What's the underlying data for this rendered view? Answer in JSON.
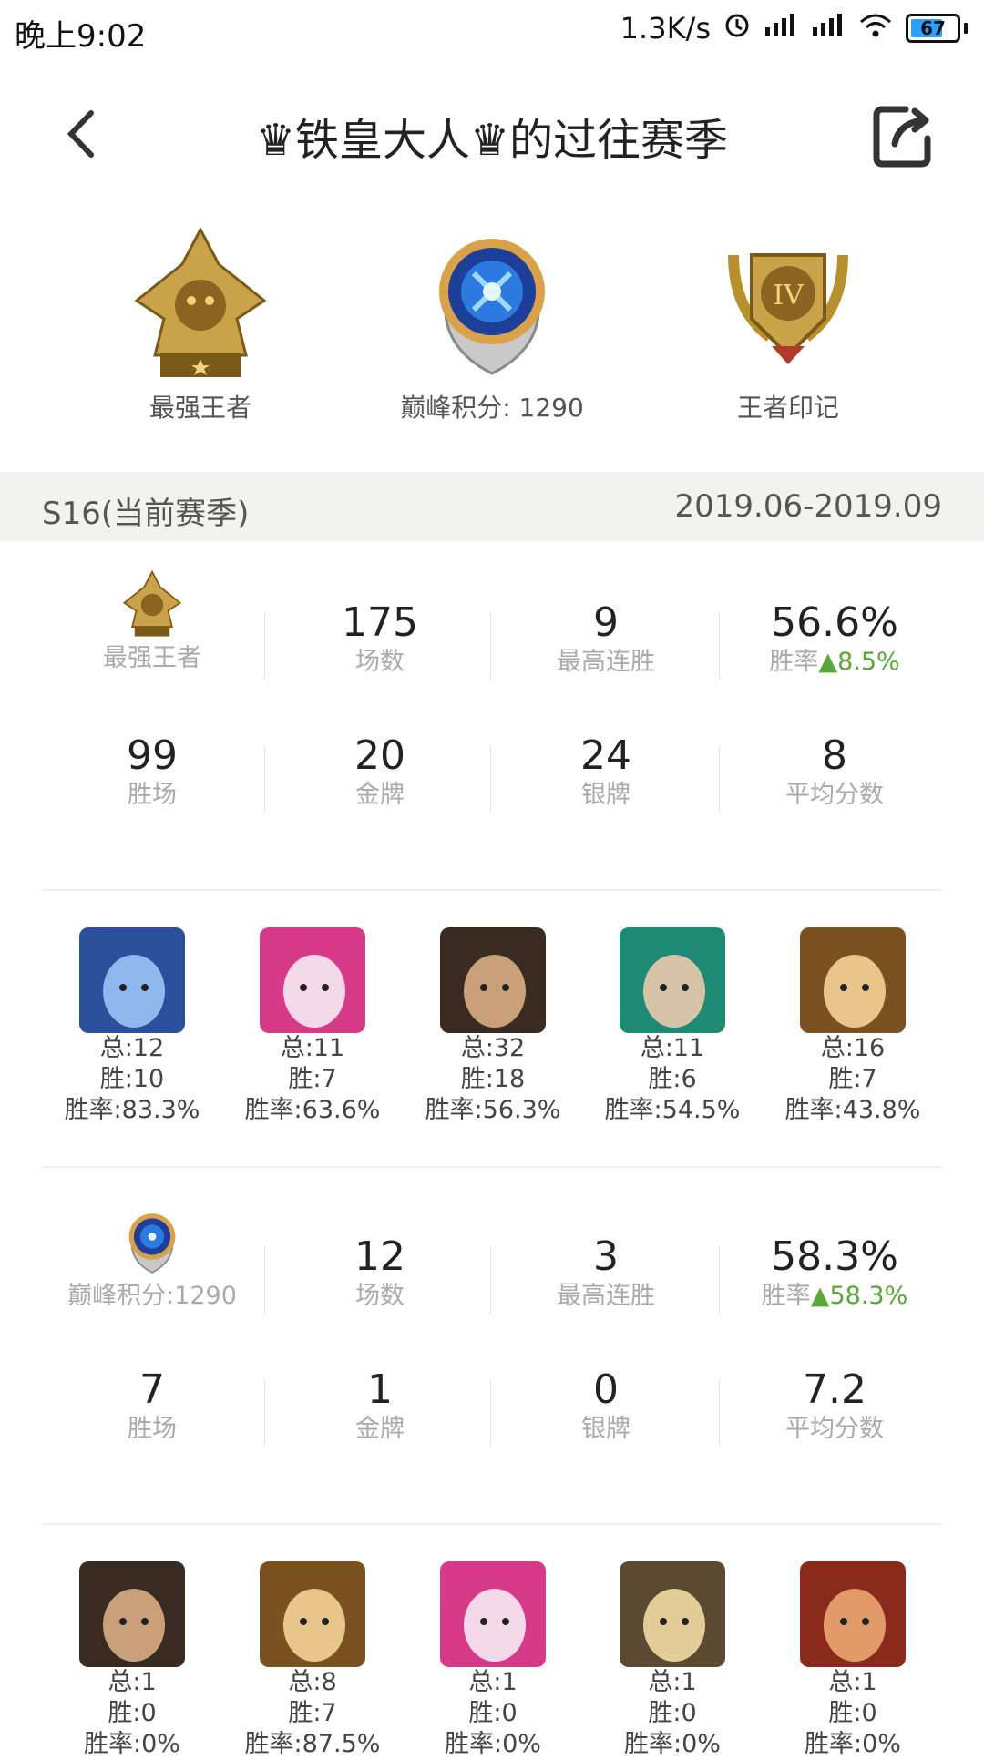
{
  "status_bar": {
    "time": "晚上9:02",
    "speed": "1.3K/s",
    "battery": "67"
  },
  "header": {
    "title": "♛铁皇大人♛的过往赛季"
  },
  "badges": [
    {
      "label": "最强王者",
      "icon": "king-rank-icon"
    },
    {
      "label": "巅峰积分: 1290",
      "icon": "peak-orb-icon"
    },
    {
      "label": "王者印记",
      "icon": "king-mark-iv-icon"
    }
  ],
  "season": {
    "name": "S16(当前赛季)",
    "dates": "2019.06-2019.09"
  },
  "sections": [
    {
      "rank_label": "最强王者",
      "row1": [
        {
          "value": "175",
          "label": "场数"
        },
        {
          "value": "9",
          "label": "最高连胜"
        },
        {
          "value": "56.6%",
          "label": "胜率",
          "delta": "▲8.5%"
        }
      ],
      "row2": [
        {
          "value": "99",
          "label": "胜场"
        },
        {
          "value": "20",
          "label": "金牌"
        },
        {
          "value": "24",
          "label": "银牌"
        },
        {
          "value": "8",
          "label": "平均分数"
        }
      ],
      "heroes": [
        {
          "total": "总:12",
          "wins": "胜:10",
          "rate": "胜率:83.3%",
          "color1": "#2b4f9a",
          "color2": "#8fb8ee"
        },
        {
          "total": "总:11",
          "wins": "胜:7",
          "rate": "胜率:63.6%",
          "color1": "#d83a8a",
          "color2": "#f4d9e8"
        },
        {
          "total": "总:32",
          "wins": "胜:18",
          "rate": "胜率:56.3%",
          "color1": "#3a2b22",
          "color2": "#caa07a"
        },
        {
          "total": "总:11",
          "wins": "胜:6",
          "rate": "胜率:54.5%",
          "color1": "#1f8a73",
          "color2": "#d7c3a8"
        },
        {
          "total": "总:16",
          "wins": "胜:7",
          "rate": "胜率:43.8%",
          "color1": "#7a5220",
          "color2": "#e8c58a"
        }
      ]
    },
    {
      "rank_label": "巅峰积分:1290",
      "row1": [
        {
          "value": "12",
          "label": "场数"
        },
        {
          "value": "3",
          "label": "最高连胜"
        },
        {
          "value": "58.3%",
          "label": "胜率",
          "delta": "▲58.3%"
        }
      ],
      "row2": [
        {
          "value": "7",
          "label": "胜场"
        },
        {
          "value": "1",
          "label": "金牌"
        },
        {
          "value": "0",
          "label": "银牌"
        },
        {
          "value": "7.2",
          "label": "平均分数"
        }
      ],
      "heroes": [
        {
          "total": "总:1",
          "wins": "胜:0",
          "rate": "胜率:0%",
          "color1": "#3a2b22",
          "color2": "#caa07a"
        },
        {
          "total": "总:8",
          "wins": "胜:7",
          "rate": "胜率:87.5%",
          "color1": "#7a5220",
          "color2": "#e8c58a"
        },
        {
          "total": "总:1",
          "wins": "胜:0",
          "rate": "胜率:0%",
          "color1": "#d83a8a",
          "color2": "#f4d9e8"
        },
        {
          "total": "总:1",
          "wins": "胜:0",
          "rate": "胜率:0%",
          "color1": "#5a4a32",
          "color2": "#e2cc98"
        },
        {
          "total": "总:1",
          "wins": "胜:0",
          "rate": "胜率:0%",
          "color1": "#8a2a1a",
          "color2": "#e39a6a"
        }
      ]
    }
  ],
  "colors": {
    "accent_up": "#5aa63a",
    "season_bar": "#f2f2f0",
    "label_gray": "#aaaaaa"
  }
}
